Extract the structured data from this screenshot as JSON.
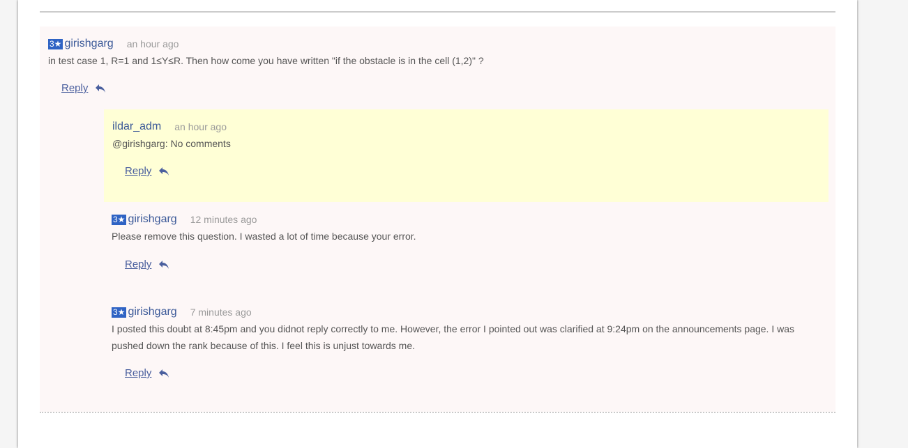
{
  "colors": {
    "badge": "#2f63c4",
    "author": "#3b5998",
    "thread_bg": "#fdf7f7",
    "admin_bg": "#ffffd6"
  },
  "comments": [
    {
      "rating": "3★",
      "author": "girishgarg",
      "time": "an hour ago",
      "text": "in test case 1, R=1 and 1≤Y≤R. Then how come you have written \"if the obstacle is in the cell (1,2)\" ?",
      "reply_label": "Reply"
    },
    {
      "author": "ildar_adm",
      "time": "an hour ago",
      "text": "@girishgarg: No comments",
      "reply_label": "Reply"
    },
    {
      "rating": "3★",
      "author": "girishgarg",
      "time": "12 minutes ago",
      "text": "Please remove this question. I wasted a lot of time because your error.",
      "reply_label": "Reply"
    },
    {
      "rating": "3★",
      "author": "girishgarg",
      "time": "7 minutes ago",
      "text": "I posted this doubt at 8:45pm and you didnot reply correctly to me. However, the error I pointed out was clarified at 9:24pm on the announcements page. I was pushed down the rank because of this. I feel this is unjust towards me.",
      "reply_label": "Reply"
    }
  ],
  "icons": {
    "reply": "reply-arrow-icon"
  }
}
